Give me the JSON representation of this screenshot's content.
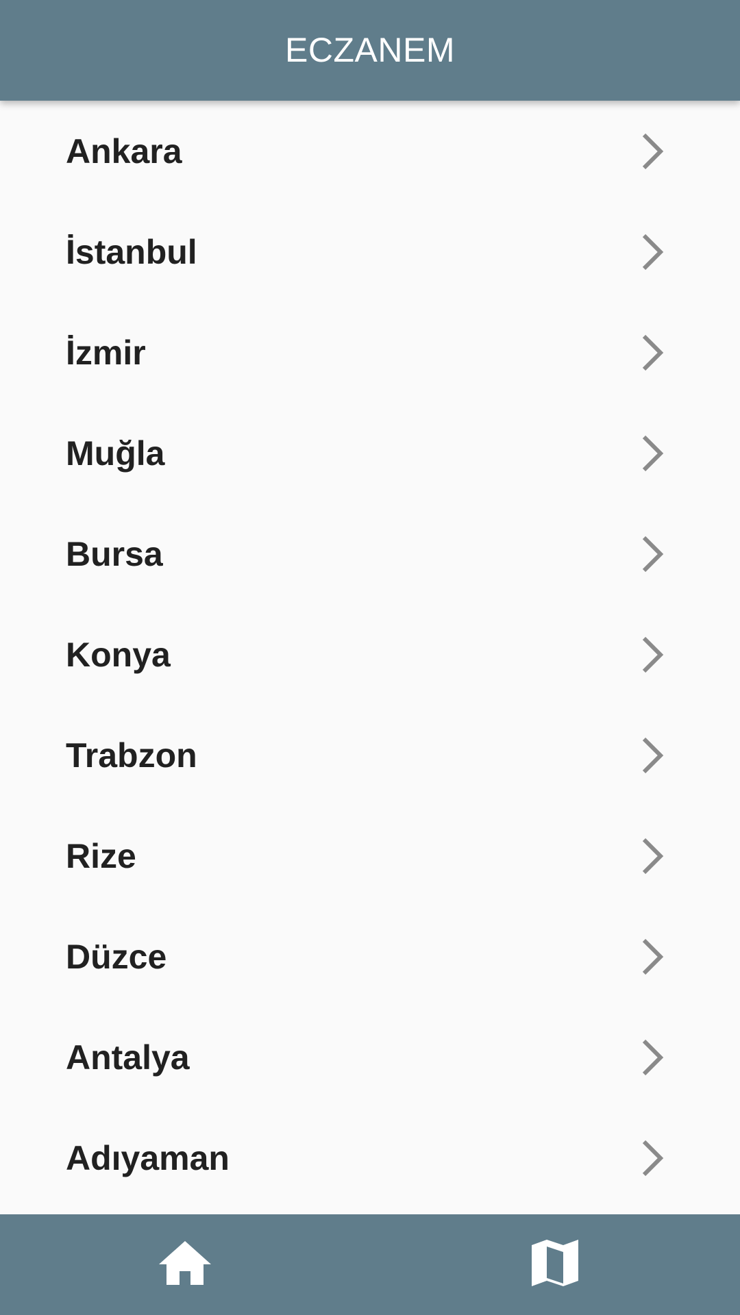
{
  "app_bar": {
    "title": "ECZANEM"
  },
  "city_list": {
    "items": [
      {
        "label": "Ankara"
      },
      {
        "label": "İstanbul"
      },
      {
        "label": "İzmir"
      },
      {
        "label": "Muğla"
      },
      {
        "label": "Bursa"
      },
      {
        "label": "Konya"
      },
      {
        "label": "Trabzon"
      },
      {
        "label": "Rize"
      },
      {
        "label": "Düzce"
      },
      {
        "label": "Antalya"
      },
      {
        "label": "Adıyaman"
      }
    ]
  },
  "bottom_nav": {
    "items": [
      {
        "icon": "home-icon"
      },
      {
        "icon": "map-icon"
      }
    ]
  },
  "colors": {
    "primary": "#607d8b",
    "background": "#fafafa",
    "text": "#212121",
    "chevron": "#8a8a8a",
    "on_primary": "#ffffff"
  }
}
